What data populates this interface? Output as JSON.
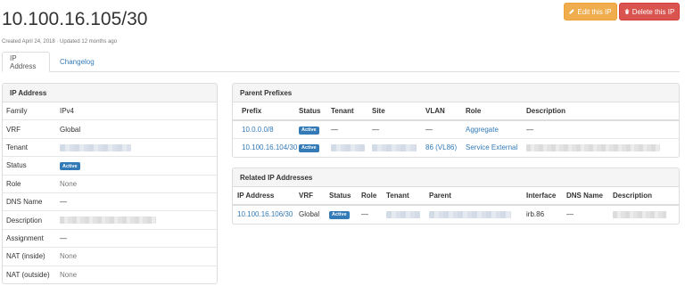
{
  "header": {
    "title": "10.100.16.105/30",
    "meta": "Created April 24, 2018 · Updated 12 months ago",
    "edit_label": "Edit this IP",
    "delete_label": "Delete this IP"
  },
  "tabs": [
    {
      "label": "IP Address",
      "active": true
    },
    {
      "label": "Changelog",
      "active": false
    }
  ],
  "ip_panel": {
    "title": "IP Address",
    "rows": [
      {
        "key": "Family",
        "value": "IPv4"
      },
      {
        "key": "VRF",
        "value": "Global"
      },
      {
        "key": "Tenant",
        "value": ""
      },
      {
        "key": "Status",
        "value": "Active"
      },
      {
        "key": "Role",
        "value": "None"
      },
      {
        "key": "DNS Name",
        "value": "—"
      },
      {
        "key": "Description",
        "value": ""
      },
      {
        "key": "Assignment",
        "value": "—"
      },
      {
        "key": "NAT (inside)",
        "value": "None"
      },
      {
        "key": "NAT (outside)",
        "value": "None"
      }
    ]
  },
  "parent_prefixes": {
    "title": "Parent Prefixes",
    "columns": [
      "Prefix",
      "Status",
      "Tenant",
      "Site",
      "VLAN",
      "Role",
      "Description"
    ],
    "rows": [
      {
        "prefix": "10.0.0.0/8",
        "status": "Active",
        "tenant": "—",
        "site": "—",
        "vlan": "—",
        "role": "Aggregate",
        "description": "—"
      },
      {
        "prefix": "10.100.16.104/30",
        "status": "Active",
        "tenant": "",
        "site": "",
        "vlan": "86 (VL86)",
        "role": "Service External",
        "description": ""
      }
    ]
  },
  "related_ips": {
    "title": "Related IP Addresses",
    "columns": [
      "IP Address",
      "VRF",
      "Status",
      "Role",
      "Tenant",
      "Parent",
      "Interface",
      "DNS Name",
      "Description"
    ],
    "rows": [
      {
        "ip": "10.100.16.106/30",
        "vrf": "Global",
        "status": "Active",
        "role": "—",
        "tenant": "",
        "parent": "",
        "interface": "irb.86",
        "dns_name": "—",
        "description": ""
      }
    ]
  },
  "colors": {
    "accent": "#337ab7",
    "warning": "#f0ad4e",
    "danger": "#d9534f"
  }
}
